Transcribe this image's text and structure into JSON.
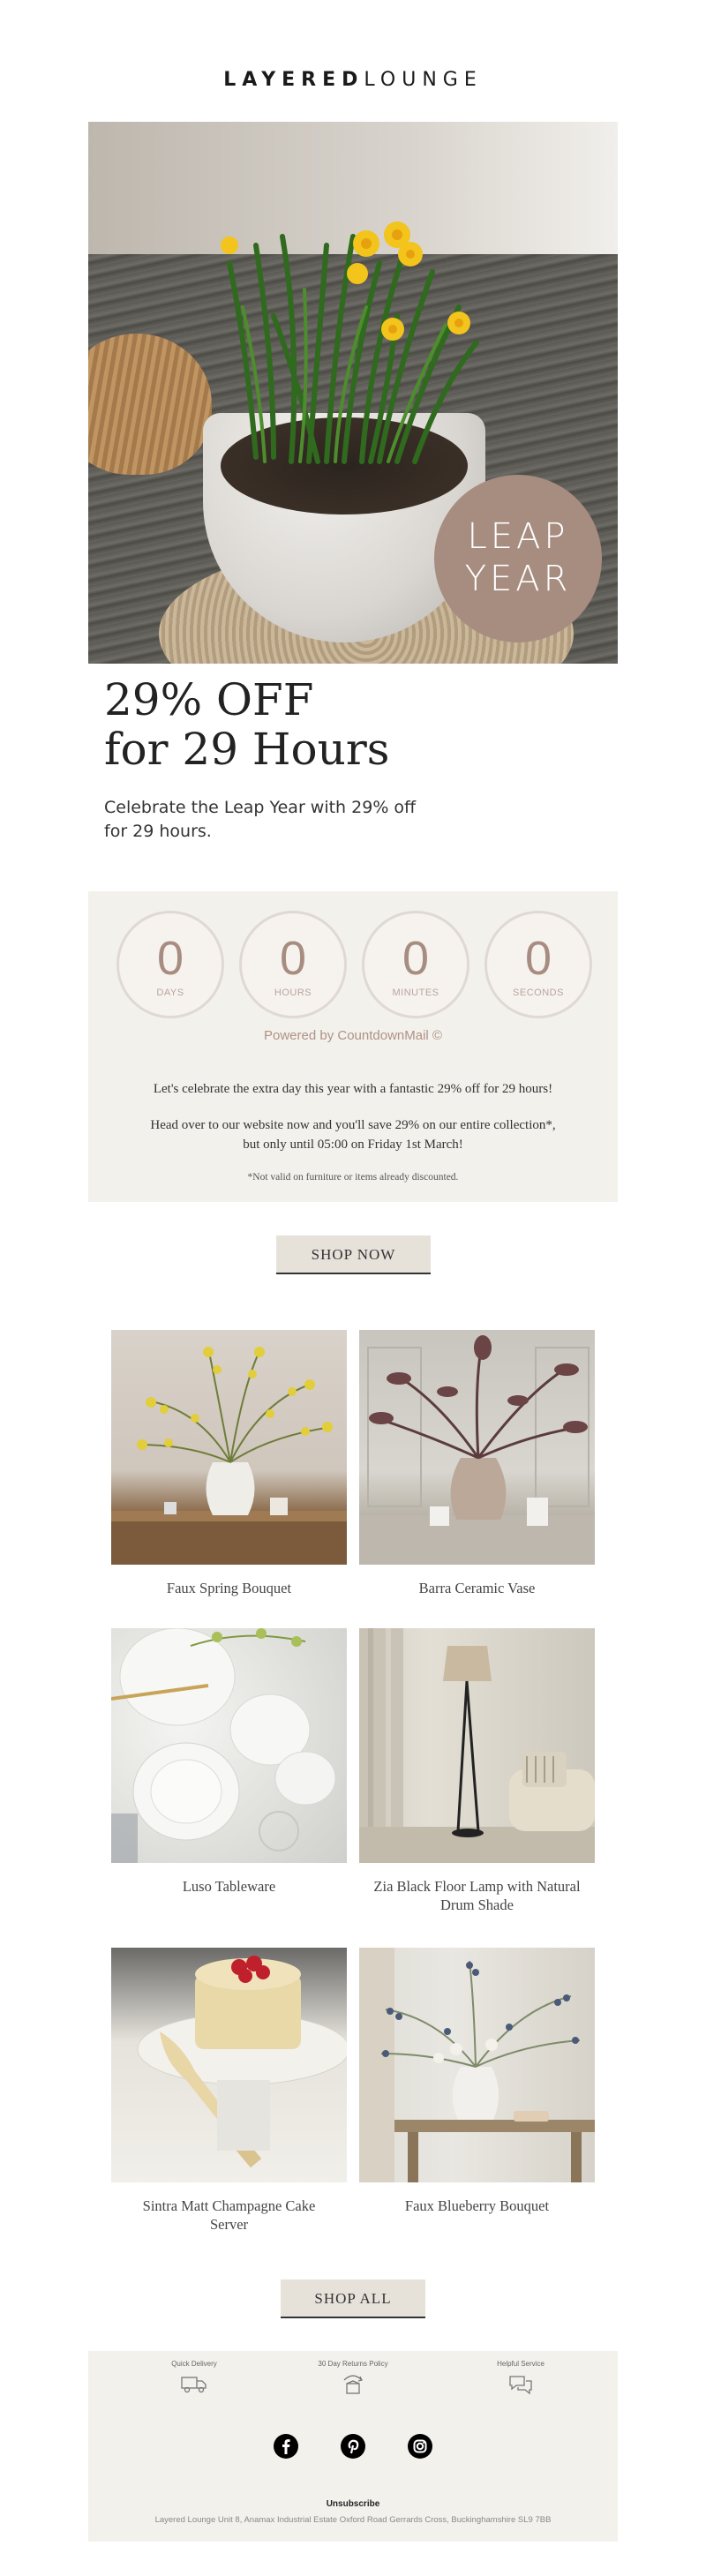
{
  "brand": {
    "logo_bold": "LAYERED",
    "logo_light": "LOUNGE"
  },
  "hero": {
    "badge_line1": "LEAP",
    "badge_line2": "YEAR"
  },
  "headline": {
    "line1": "29% OFF",
    "line2": "for 29 Hours"
  },
  "subline": {
    "line1": "Celebrate the Leap Year with 29% off",
    "line2": "for 29 hours."
  },
  "countdown": {
    "units": [
      {
        "value": "0",
        "label": "DAYS"
      },
      {
        "value": "0",
        "label": "HOURS"
      },
      {
        "value": "0",
        "label": "MINUTES"
      },
      {
        "value": "0",
        "label": "SECONDS"
      }
    ],
    "powered_by": "Powered by CountdownMail ©",
    "text1": "Let's celebrate the extra day this year with a fantastic 29% off for 29 hours!",
    "text2a": "Head over to our website now and you'll save 29% on our entire collection*,",
    "text2b": "but only until 05:00 on Friday 1st March!",
    "disclaimer": "*Not valid on furniture or items already discounted.",
    "accent_color": "#a78c80"
  },
  "cta": {
    "shop_now": "SHOP NOW",
    "shop_all": "SHOP ALL"
  },
  "products": [
    {
      "name": "Faux Spring Bouquet"
    },
    {
      "name": "Barra Ceramic Vase"
    },
    {
      "name": "Luso Tableware"
    },
    {
      "name_line1": "Zia Black Floor Lamp with Natural",
      "name_line2": "Drum Shade"
    },
    {
      "name_line1": "Sintra Matt Champagne Cake",
      "name_line2": "Server"
    },
    {
      "name": "Faux Blueberry Bouquet"
    }
  ],
  "footer": {
    "features": [
      {
        "label": "Quick Delivery",
        "icon": "truck-icon"
      },
      {
        "label": "30 Day Returns Policy",
        "icon": "returns-box-icon"
      },
      {
        "label": "Helpful Service",
        "icon": "chat-bubbles-icon"
      }
    ],
    "socials": [
      "facebook-icon",
      "pinterest-icon",
      "instagram-icon"
    ],
    "unsubscribe": "Unsubscribe",
    "address": "Layered Lounge Unit 8, Anamax Industrial Estate Oxford Road Gerrards Cross, Buckinghamshire SL9 7BB"
  }
}
